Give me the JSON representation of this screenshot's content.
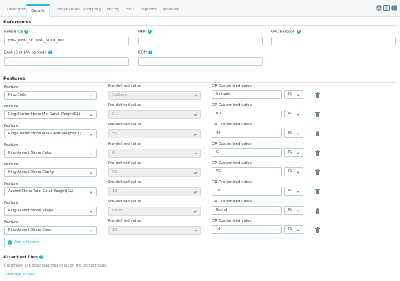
{
  "tabs": [
    {
      "label": "Description"
    },
    {
      "label": "Details"
    },
    {
      "label": "Combinations"
    },
    {
      "label": "Shopping"
    },
    {
      "label": "Pricing"
    },
    {
      "label": "SEO"
    },
    {
      "label": "Options"
    },
    {
      "label": "Modules"
    }
  ],
  "active_tab": "Details",
  "references": {
    "title": "References",
    "reference_label": "Reference",
    "reference_value": "ENG_RING_SETTING_SOLIT_001",
    "mpn_label": "MPN",
    "mpn_value": "",
    "upc_label": "UPC barcode",
    "upc_value": "",
    "ean_label": "EAN-13 or JAN barcode",
    "ean_value": "",
    "isbn_label": "ISBN",
    "isbn_value": ""
  },
  "features": {
    "title": "Features",
    "feature_label": "Feature",
    "predefined_label": "Pre-defined value",
    "custom_label": "OR Customized value",
    "rows": [
      {
        "feature": "Ring Style",
        "predefined": "Solitaire",
        "custom": "Solitaire",
        "lang": "PL"
      },
      {
        "feature": "Ring Center Stone Min Carat Weight(CL)",
        "predefined": "0.1",
        "custom": "0.1",
        "lang": "PL"
      },
      {
        "feature": "Ring Center Stone Max Carat Weight(CL)",
        "predefined": "50",
        "custom": "50",
        "lang": "PL"
      },
      {
        "feature": "Ring Accent Stone Color",
        "predefined": "G",
        "custom": "G",
        "lang": "PL"
      },
      {
        "feature": "Ring Accent Stone Clarity",
        "predefined": "VS",
        "custom": "VS",
        "lang": "PL"
      },
      {
        "feature": "Accent Stone Total Carat Weight(CL)",
        "predefined": "10",
        "custom": "10",
        "lang": "PL"
      },
      {
        "feature": "Ring Accent Stone Shape",
        "predefined": "Round",
        "custom": "Round",
        "lang": "PL"
      },
      {
        "feature": "Ring Accent Stone Count",
        "predefined": "10",
        "custom": "10",
        "lang": "PL"
      }
    ],
    "add_button": "Add a feature"
  },
  "attached_files": {
    "title": "Attached files",
    "note": "Customers can download these files on the product page.",
    "manage_link": "Manage all files"
  },
  "colors": {
    "accent": "#25b9d7",
    "border": "#bbcdd2",
    "text": "#363a41",
    "muted": "#6c868e"
  }
}
